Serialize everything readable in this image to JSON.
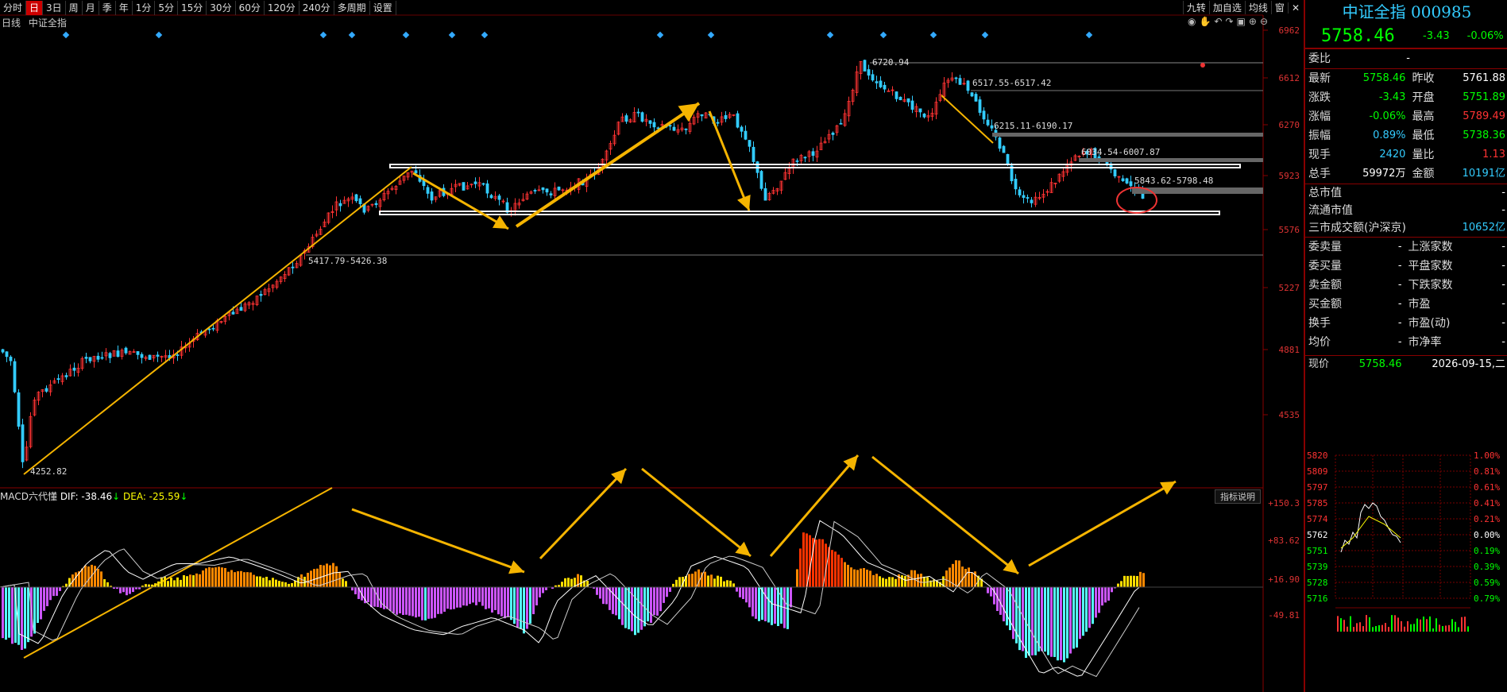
{
  "toolbar": {
    "items": [
      "分时",
      "日",
      "3日",
      "周",
      "月",
      "季",
      "年",
      "1分",
      "5分",
      "15分",
      "30分",
      "60分",
      "120分",
      "240分",
      "多周期",
      "设置"
    ],
    "active_index": 1,
    "right_items": [
      "九转",
      "加自选",
      "均线",
      "窗",
      "✕"
    ]
  },
  "chart_header": {
    "period": "日线",
    "index_name": "中证全指"
  },
  "y_axis": {
    "labels": [
      "6962",
      "6612",
      "6270",
      "5923",
      "5576",
      "5227",
      "4881",
      "4535"
    ],
    "color": "#dd3333"
  },
  "annotations": {
    "peak": "6720.94",
    "level1": "6517.55-6517.42",
    "level2": "6215.11-6190.17",
    "level3": "6034.54-6007.87",
    "level4": "5843.62-5798.48",
    "support": "5417.79-5426.38",
    "low": "4252.82"
  },
  "macd": {
    "title": "MACD六代懂",
    "dif_label": "DIF: -38.46",
    "dea_label": "DEA: -25.59",
    "button": "指标说明",
    "y_labels": [
      "+150.3",
      "+83.62",
      "+16.90",
      "-49.81"
    ]
  },
  "panel": {
    "title": "中证全指 000985",
    "price": "5758.46",
    "change": "-3.43",
    "change_pct": "-0.06%",
    "weibi_label": "委比",
    "weibi_value": "-",
    "stats": [
      {
        "l1": "最新",
        "v1": "5758.46",
        "c1": "green",
        "l2": "昨收",
        "v2": "5761.88",
        "c2": "white"
      },
      {
        "l1": "涨跌",
        "v1": "-3.43",
        "c1": "green",
        "l2": "开盘",
        "v2": "5751.89",
        "c2": "green"
      },
      {
        "l1": "涨幅",
        "v1": "-0.06%",
        "c1": "green",
        "l2": "最高",
        "v2": "5789.49",
        "c2": "red"
      },
      {
        "l1": "振幅",
        "v1": "0.89%",
        "c1": "cyan",
        "l2": "最低",
        "v2": "5738.36",
        "c2": "green"
      },
      {
        "l1": "现手",
        "v1": "2420",
        "c1": "cyan",
        "l2": "量比",
        "v2": "1.13",
        "c2": "red"
      },
      {
        "l1": "总手",
        "v1": "59972万",
        "c1": "white",
        "l2": "金额",
        "v2": "10191亿",
        "c2": "cyan"
      }
    ],
    "market": [
      {
        "l": "总市值",
        "v": "-"
      },
      {
        "l": "流通市值",
        "v": "-"
      },
      {
        "l": "三市成交额(沪深京)",
        "v": "10652亿"
      }
    ],
    "extra": [
      {
        "l1": "委卖量",
        "v1": "-",
        "l2": "上涨家数",
        "v2": "-"
      },
      {
        "l1": "委买量",
        "v1": "-",
        "l2": "平盘家数",
        "v2": "-"
      },
      {
        "l1": "卖金额",
        "v1": "-",
        "l2": "下跌家数",
        "v2": "-"
      },
      {
        "l1": "买金额",
        "v1": "-",
        "l2": "市盈",
        "v2": "-"
      },
      {
        "l1": "换手",
        "v1": "-",
        "l2": "市盈(动)",
        "v2": "-"
      },
      {
        "l1": "均价",
        "v1": "-",
        "l2": "市净率",
        "v2": "-"
      }
    ],
    "mini": {
      "label": "现价",
      "price": "5758.46",
      "date": "2026-09-15,二",
      "y_left": [
        "5820",
        "5809",
        "5797",
        "5785",
        "5774",
        "5762",
        "5751",
        "5739",
        "5728",
        "5716"
      ],
      "y_right": [
        "1.00%",
        "0.81%",
        "0.61%",
        "0.41%",
        "0.21%",
        "0.00%",
        "0.19%",
        "0.39%",
        "0.59%",
        "0.79%"
      ]
    }
  }
}
